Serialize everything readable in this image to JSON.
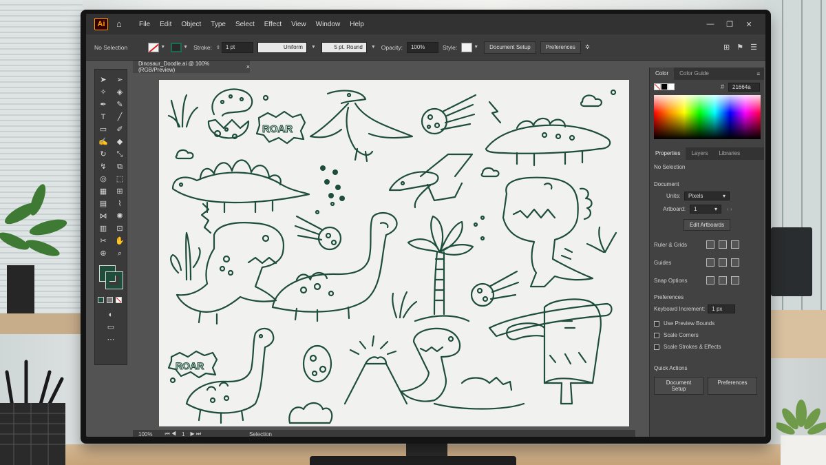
{
  "app": {
    "logo_text": "Ai",
    "menu": [
      "File",
      "Edit",
      "Object",
      "Type",
      "Select",
      "Effect",
      "View",
      "Window",
      "Help"
    ]
  },
  "control_bar": {
    "selection_label": "No Selection",
    "stroke_label": "Stroke:",
    "stroke_value": "1 pt",
    "profile_label": "Uniform",
    "brush_label": "5 pt. Round",
    "opacity_label": "Opacity:",
    "opacity_value": "100%",
    "style_label": "Style:",
    "document_setup": "Document Setup",
    "preferences": "Preferences"
  },
  "document": {
    "tab_title": "Dinosaur_Doodle.ai @ 100% (RGB/Preview)",
    "close_glyph": "×"
  },
  "status_bar": {
    "zoom": "100%",
    "artboard_nav": "1",
    "tool": "Selection"
  },
  "color_panel": {
    "tabs": [
      "Color",
      "Color Guide"
    ],
    "hex_label": "#",
    "hex_value": "21664a"
  },
  "properties_panel": {
    "tabs": [
      "Properties",
      "Layers",
      "Libraries"
    ],
    "selection": "No Selection",
    "document_title": "Document",
    "units_label": "Units:",
    "units_value": "Pixels",
    "artboard_label": "Artboard:",
    "artboard_value": "1",
    "edit_artboards": "Edit Artboards",
    "rulers_grids": "Ruler & Grids",
    "guides": "Guides",
    "snap_options": "Snap Options",
    "preferences_title": "Preferences",
    "keyboard_increment_label": "Keyboard Increment:",
    "keyboard_increment_value": "1 px",
    "checkboxes": [
      "Use Preview Bounds",
      "Scale Corners",
      "Scale Strokes & Effects"
    ],
    "quick_actions": "Quick Actions",
    "qa_document_setup": "Document Setup",
    "qa_preferences": "Preferences"
  },
  "artwork": {
    "ink_color": "#1e4d3c",
    "roar_1": "ROAR",
    "roar_2": "ROAR"
  },
  "colors": {
    "fill": "#1e4d3c",
    "accent": "#ff9a00"
  }
}
